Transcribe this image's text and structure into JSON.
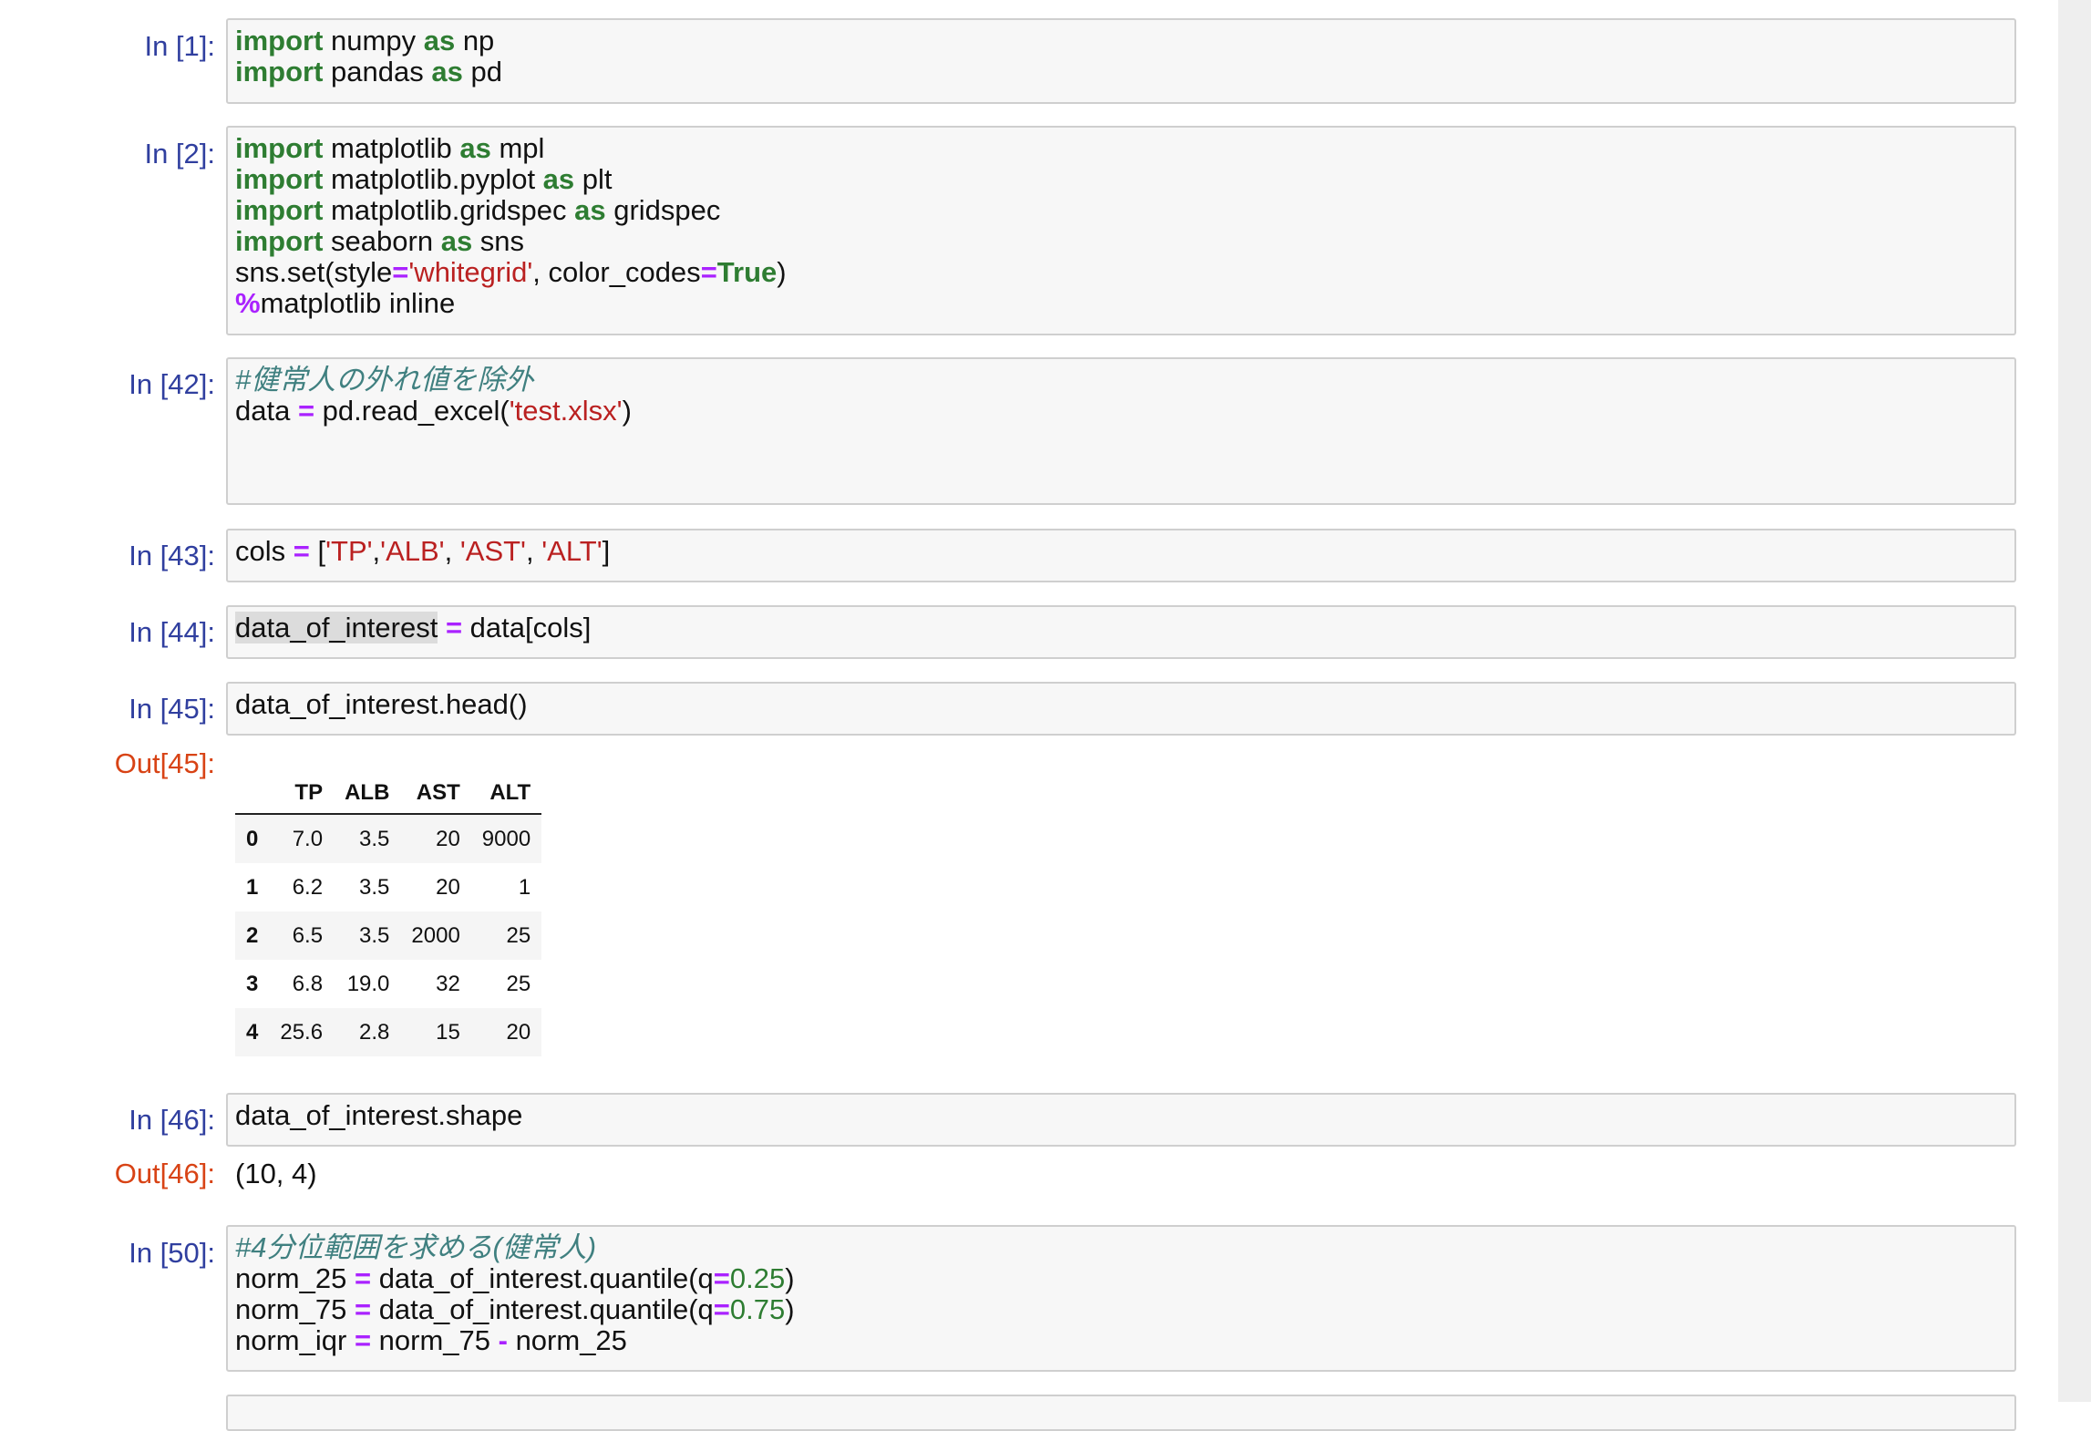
{
  "prompts": {
    "in1": "In [1]:",
    "in2": "In [2]:",
    "in42": "In [42]:",
    "in43": "In [43]:",
    "in44": "In [44]:",
    "in45": "In [45]:",
    "out45": "Out[45]:",
    "in46": "In [46]:",
    "out46": "Out[46]:",
    "in50": "In [50]:"
  },
  "cells": {
    "c1": {
      "l1_kw": "import",
      "l1_mod": " numpy ",
      "l1_as": "as",
      "l1_alias": " np",
      "l2_kw": "import",
      "l2_mod": " pandas ",
      "l2_as": "as",
      "l2_alias": " pd"
    },
    "c2": {
      "l1_kw": "import",
      "l1_mod": " matplotlib ",
      "l1_as": "as",
      "l1_alias": " mpl",
      "l2_kw": "import",
      "l2_mod": " matplotlib.pyplot ",
      "l2_as": "as",
      "l2_alias": " plt",
      "l3_kw": "import",
      "l3_mod": " matplotlib.gridspec ",
      "l3_as": "as",
      "l3_alias": " gridspec",
      "l4_kw": "import",
      "l4_mod": " seaborn ",
      "l4_as": "as",
      "l4_alias": " sns",
      "l5_a": "sns.set(style",
      "l5_eq1": "=",
      "l5_str": "'whitegrid'",
      "l5_b": ", color_codes",
      "l5_eq2": "=",
      "l5_true": "True",
      "l5_c": ")",
      "l6_pct": "%",
      "l6_rest": "matplotlib inline"
    },
    "c42": {
      "comment": "#健常人の外れ値を除外",
      "l2_a": "data ",
      "l2_eq": "=",
      "l2_b": " pd.read_excel(",
      "l2_str": "'test.xlsx'",
      "l2_c": ")"
    },
    "c43": {
      "a": "cols ",
      "eq": "=",
      "b": " [",
      "s1": "'TP'",
      "c1": ",",
      "s2": "'ALB'",
      "c2": ", ",
      "s3": "'AST'",
      "c3": ", ",
      "s4": "'ALT'",
      "e": "]"
    },
    "c44": {
      "hl": "data_of_interest",
      "b": " ",
      "eq": "=",
      "c": " data[cols]"
    },
    "c45": {
      "code": "data_of_interest.head()"
    },
    "c46": {
      "code": "data_of_interest.shape"
    },
    "c50": {
      "comment": "#4分位範囲を求める(健常人)",
      "l2_a": "norm_25 ",
      "l2_eq": "=",
      "l2_b": " data_of_interest.quantile(q",
      "l2_eq2": "=",
      "l2_num": "0.25",
      "l2_c": ")",
      "l3_a": "norm_75 ",
      "l3_eq": "=",
      "l3_b": " data_of_interest.quantile(q",
      "l3_eq2": "=",
      "l3_num": "0.75",
      "l3_c": ")",
      "l4_a": "norm_iqr ",
      "l4_eq": "=",
      "l4_b": " norm_75 ",
      "l4_minus": "-",
      "l4_c": " norm_25"
    }
  },
  "outputs": {
    "out46": "(10, 4)",
    "table": {
      "columns": [
        "TP",
        "ALB",
        "AST",
        "ALT"
      ],
      "rows": [
        {
          "index": "0",
          "values": [
            "7.0",
            "3.5",
            "20",
            "9000"
          ]
        },
        {
          "index": "1",
          "values": [
            "6.2",
            "3.5",
            "20",
            "1"
          ]
        },
        {
          "index": "2",
          "values": [
            "6.5",
            "3.5",
            "2000",
            "25"
          ]
        },
        {
          "index": "3",
          "values": [
            "6.8",
            "19.0",
            "32",
            "25"
          ]
        },
        {
          "index": "4",
          "values": [
            "25.6",
            "2.8",
            "15",
            "20"
          ]
        }
      ]
    }
  },
  "colors": {
    "in_prompt": "#303f9f",
    "out_prompt": "#d84315",
    "keyword": "#2e7d32",
    "operator": "#aa22ff",
    "string": "#ba2121",
    "comment": "#408080"
  }
}
